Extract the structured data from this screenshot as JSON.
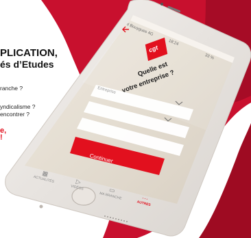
{
  "promo": {
    "headline_line1": "PLICATION,",
    "headline_line2": "és d’Etudes",
    "question1": "ranche ?",
    "question2": "yndicalisme ?",
    "question3": "encontrer ?",
    "cta_line1": "e,",
    "cta_line2": "!"
  },
  "status_bar": {
    "carrier": "ıl Bouygues 4G",
    "time": "18:24",
    "battery": "33 %"
  },
  "logo": {
    "text": "cgt"
  },
  "form": {
    "question_line1": "Quelle est",
    "question_line2": "votre entreprise ?",
    "company_placeholder": "Entreprise",
    "continue_label": "Continuer"
  },
  "tabbar": {
    "items": [
      {
        "label": "ACTUALITÉS",
        "icon": "grid-icon"
      },
      {
        "label": "VIDÉOS",
        "icon": "play-icon"
      },
      {
        "label": "MA BRANCHE",
        "icon": "folder-icon"
      },
      {
        "label": "AUTRES",
        "icon": "more-icon"
      }
    ]
  },
  "colors": {
    "accent_red": "#e2101e",
    "background_red": "#c8102e"
  }
}
